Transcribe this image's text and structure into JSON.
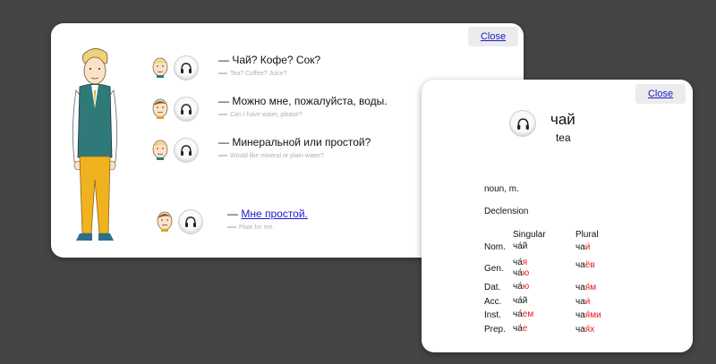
{
  "dialog": {
    "close_label": "Close",
    "lines": [
      {
        "text": "— Чай? Кофе? Сок?",
        "translation": "Tea? Coffee? Juice?"
      },
      {
        "text": "— Можно мне, пожалуйста, воды.",
        "translation": "Can I have water, please?"
      },
      {
        "text": "— Минеральной или простой?",
        "translation": "Would like mineral or plain water?"
      }
    ],
    "answer": {
      "dash": "—",
      "link": "Мне простой.",
      "translation": "Plain for me."
    }
  },
  "card": {
    "close_label": "Close",
    "word": "чай",
    "translation": "tea",
    "part_of_speech": "noun, m.",
    "declension_label": "Declension",
    "singular_header": "Singular",
    "plural_header": "Plural",
    "cases": [
      "Nom.",
      "Gen.",
      "Dat.",
      "Acc.",
      "Inst.",
      "Prep."
    ],
    "singular": [
      [
        [
          "ча́й",
          ""
        ]
      ],
      [
        [
          "ча́",
          "я"
        ],
        [
          "ча́",
          "ю"
        ]
      ],
      [
        [
          "ча́",
          "ю"
        ]
      ],
      [
        [
          "ча́й",
          ""
        ]
      ],
      [
        [
          "ча́",
          "ем"
        ]
      ],
      [
        [
          "ча́",
          "е"
        ]
      ]
    ],
    "plural": [
      [
        "ча",
        "и́"
      ],
      [
        "ча",
        "ёв"
      ],
      [
        "ча",
        "я́м"
      ],
      [
        "ча",
        "и́"
      ],
      [
        "ча",
        "я́ми"
      ],
      [
        "ча",
        "я́х"
      ]
    ]
  },
  "colors": {
    "ending": "#e41b1b",
    "link": "#1a1acc",
    "background": "#454545"
  },
  "icons": [
    "headphones-icon",
    "waiter-avatar-icon",
    "guest-avatar-icon"
  ]
}
